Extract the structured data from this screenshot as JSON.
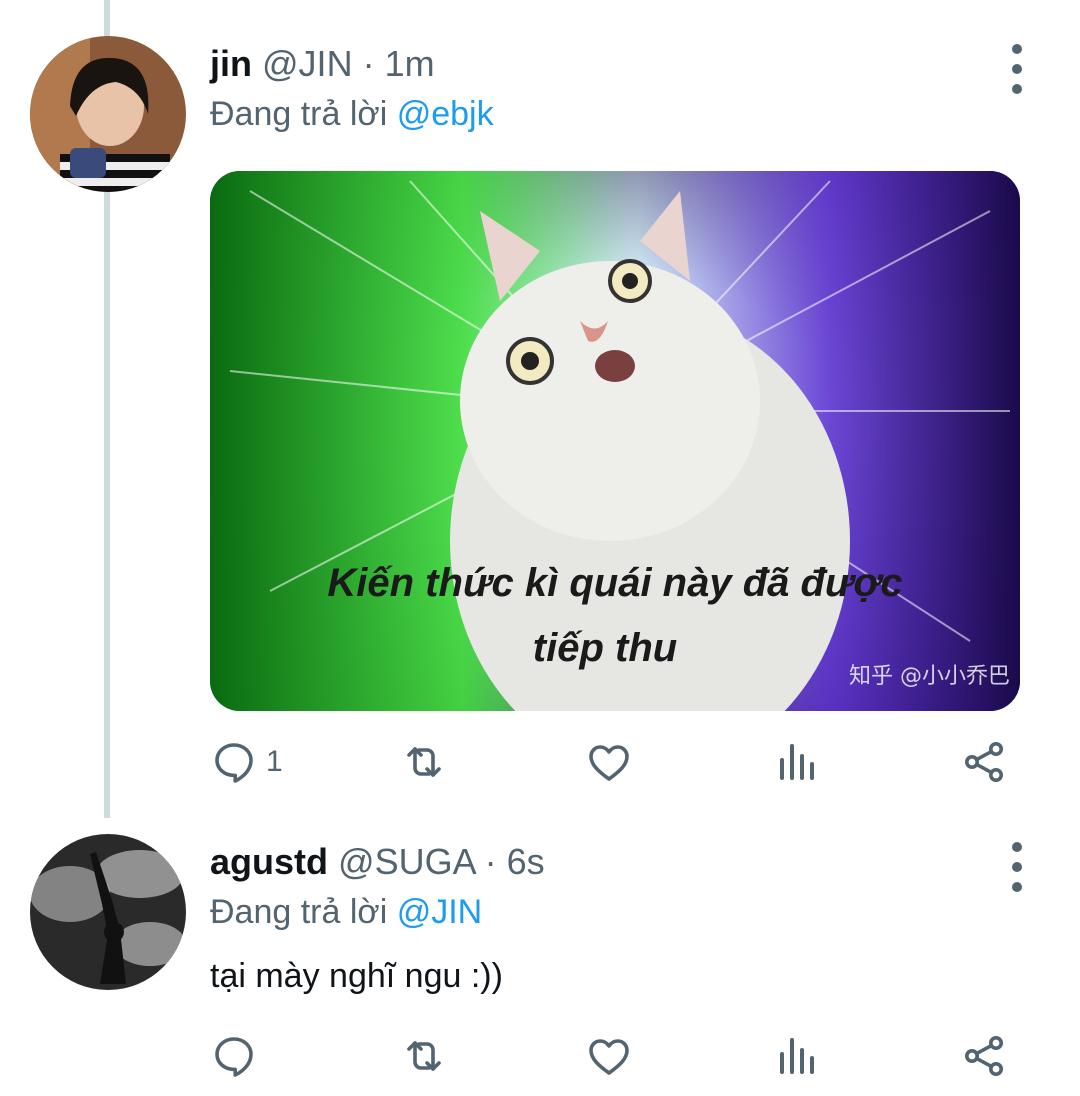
{
  "tweets": [
    {
      "name": "jin",
      "handle": "@JIN",
      "separator": "·",
      "time": "1m",
      "reply_prefix": "Đang trả lời",
      "reply_to": "@ebjk",
      "media": {
        "caption_line1": "Kiến thức kì quái này đã được",
        "caption_line2": "tiếp thu",
        "watermark": "知乎 @小小乔巴"
      },
      "reply_count": "1"
    },
    {
      "name": "agustd",
      "handle": "@SUGA",
      "separator": "·",
      "time": "6s",
      "reply_prefix": "Đang trả lời",
      "reply_to": "@JIN",
      "text": "tại mày nghĩ ngu :))",
      "reply_count": ""
    }
  ],
  "icons": [
    "reply-icon",
    "retweet-icon",
    "like-icon",
    "views-icon",
    "share-icon",
    "more-icon"
  ],
  "colors": {
    "accent": "#1d9bf0",
    "muted": "#536471",
    "thread_line": "#cfd9de"
  }
}
